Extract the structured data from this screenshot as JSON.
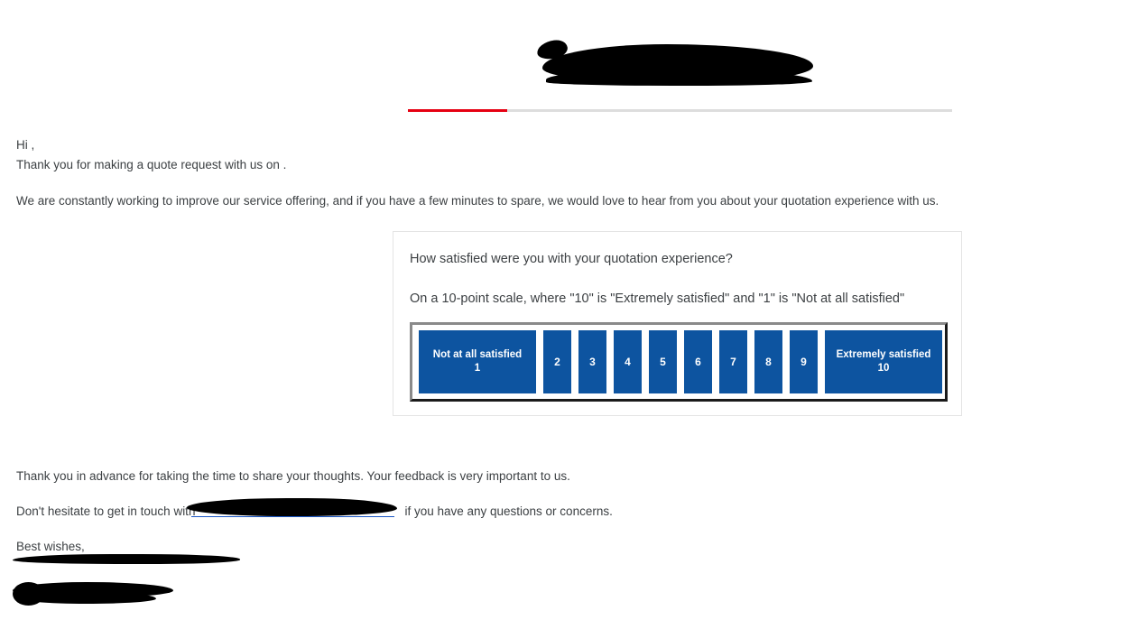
{
  "header": {
    "logo_redacted": true,
    "divider_red_color": "#e60012",
    "divider_grey_color": "#dddddd"
  },
  "email": {
    "greeting": "Hi ,",
    "thank_you_line": "Thank you for making a quote request with us on .",
    "intro_paragraph": "We are constantly working to improve our service offering, and if you have a few minutes to spare, we would love to hear from you about your quotation experience with us.",
    "closing_paragraph": "Thank you in advance for taking the time to share your thoughts. Your feedback is very important to us.",
    "contact_line_prefix": "Don't hesitate to get in touch with",
    "contact_line_suffix": "if you have any questions or concerns.",
    "signoff": "Best wishes,",
    "signature_redacted": true
  },
  "survey": {
    "question": "How satisfied were you with your quotation experience?",
    "subtitle": "On a 10-point scale, where \"10\" is \"Extremely satisfied\" and \"1\" is \"Not at all satisfied\"",
    "accent_color": "#0d54a0",
    "options": [
      {
        "label": "Not at all satisfied",
        "value": "1"
      },
      {
        "label": "",
        "value": "2"
      },
      {
        "label": "",
        "value": "3"
      },
      {
        "label": "",
        "value": "4"
      },
      {
        "label": "",
        "value": "5"
      },
      {
        "label": "",
        "value": "6"
      },
      {
        "label": "",
        "value": "7"
      },
      {
        "label": "",
        "value": "8"
      },
      {
        "label": "",
        "value": "9"
      },
      {
        "label": "Extremely satisfied",
        "value": "10"
      }
    ]
  }
}
